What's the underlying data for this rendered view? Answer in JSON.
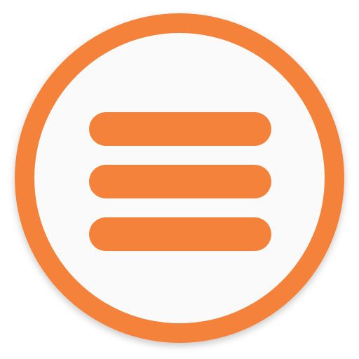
{
  "icon": {
    "name": "hamburger-menu-icon",
    "ring_color": "#F4823A",
    "inner_color": "#FAFAFA",
    "bar_color": "#F4823A",
    "bar_count": 3
  }
}
